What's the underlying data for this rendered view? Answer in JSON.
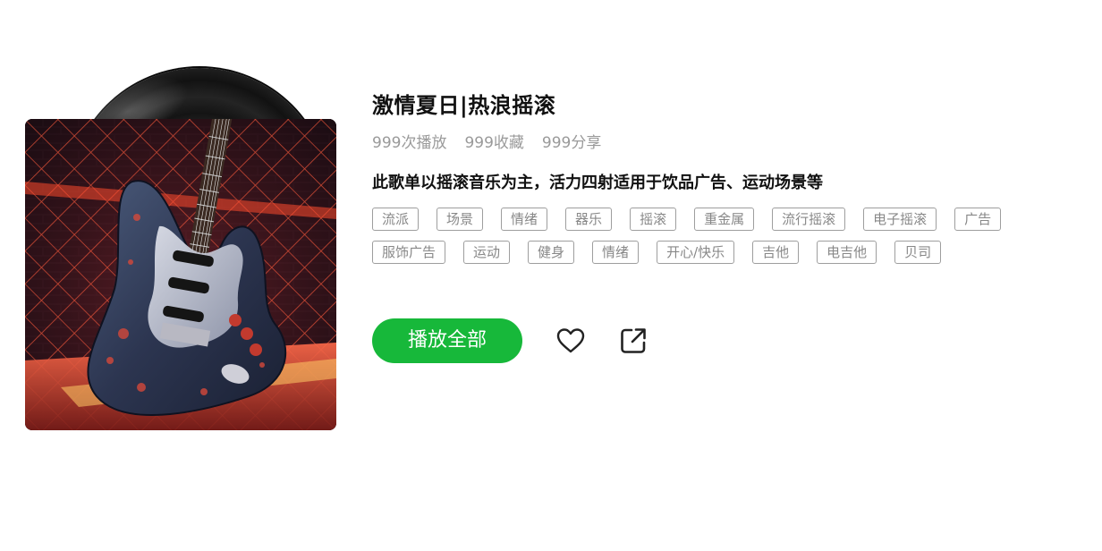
{
  "playlist": {
    "title": "激情夏日|热浪摇滚",
    "stats": {
      "plays": "999次播放",
      "favorites": "999收藏",
      "shares": "999分享"
    },
    "description": "此歌单以摇滚音乐为主，活力四射适用于饮品广告、运动场景等",
    "tags": [
      "流派",
      "场景",
      "情绪",
      "器乐",
      "摇滚",
      "重金属",
      "流行摇滚",
      "电子摇滚",
      "广告",
      "服饰广告",
      "运动",
      "健身",
      "情绪",
      "开心/快乐",
      "吉他",
      "电吉他",
      "贝司"
    ],
    "cover_icon": "electric-guitar-artwork",
    "vinyl_icon": "vinyl-record"
  },
  "actions": {
    "play_all_label": "播放全部",
    "favorite_icon": "heart-outline-icon",
    "share_icon": "share-external-icon"
  },
  "colors": {
    "accent": "#17b83a",
    "title": "#111111",
    "muted": "#9a9a9a",
    "tag_border": "#9e9e9e"
  }
}
